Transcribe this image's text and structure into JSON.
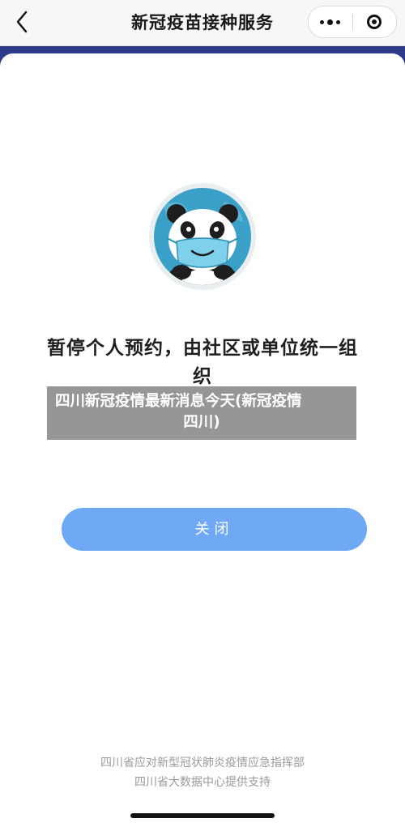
{
  "nav": {
    "title": "新冠疫苗接种服务",
    "back_icon": "chevron-left-icon",
    "more_icon": "more-dots-icon",
    "close_icon": "target-circle-icon"
  },
  "dialog": {
    "message_line1": "暂停个人预约，由社区或单位统一组",
    "message_line2": "织",
    "close_label": "关闭",
    "mascot_icon": "panda-mask-avatar"
  },
  "overlay": {
    "line1": "四川新冠疫情最新消息今天(新冠疫情",
    "line2": "四川)"
  },
  "footer": {
    "line1": "四川省应对新型冠状肺炎疫情应急指挥部",
    "line2": "四川省大数据中心提供支持"
  },
  "colors": {
    "button": "#6fa9f5",
    "backdrop": "#2d3b8a",
    "mascot_ring": "#3aa0c8"
  }
}
